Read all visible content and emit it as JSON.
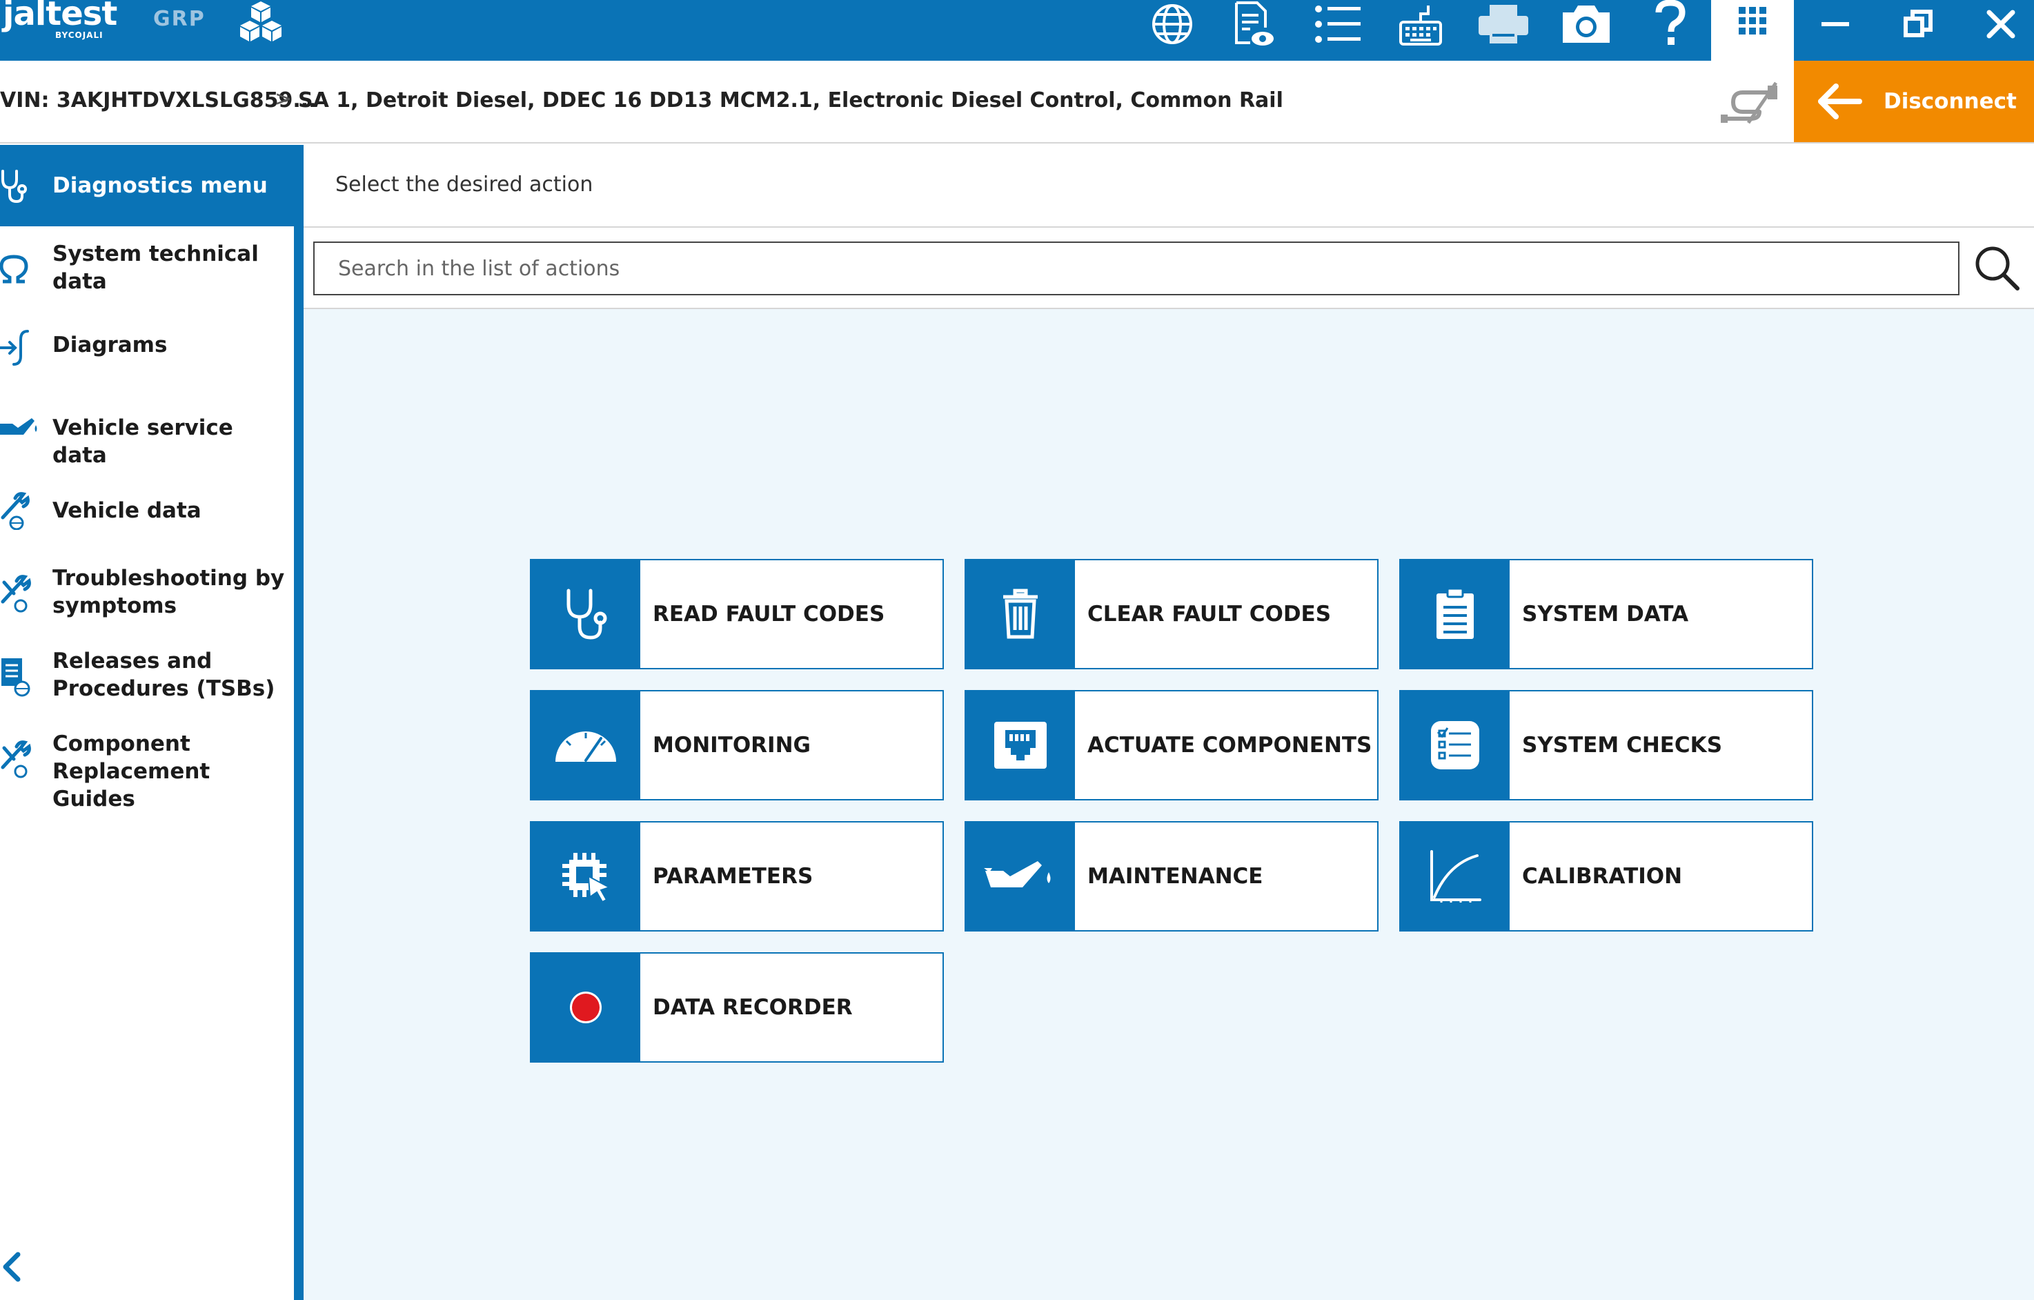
{
  "app": {
    "logo_text": "jaltest",
    "logo_sub": "BYCOJALI",
    "grp_label": "GRP"
  },
  "toolbar": {
    "icons": [
      "globe-icon",
      "document-view-icon",
      "list-icon",
      "keyboard-icon",
      "printer-icon",
      "camera-icon",
      "help-icon",
      "apps-grid-icon"
    ],
    "window_controls": [
      "minimize-icon",
      "restore-icon",
      "close-icon"
    ]
  },
  "breadcrumb": {
    "vin": "VIN: 3AKJHTDVXLSLG859...",
    "separator": ">",
    "system": "SA 1, Detroit Diesel, DDEC 16 DD13 MCM2.1, Electronic Diesel Control, Common Rail"
  },
  "disconnect": {
    "label": "Disconnect"
  },
  "sidebar": {
    "items": [
      {
        "label": "Diagnostics menu",
        "icon": "stethoscope-icon"
      },
      {
        "label": "System technical data",
        "icon": "omega-icon"
      },
      {
        "label": "Diagrams",
        "icon": "wiring-icon"
      },
      {
        "label": "Vehicle service data",
        "icon": "oil-can-icon"
      },
      {
        "label": "Vehicle data",
        "icon": "wrench-globe-icon"
      },
      {
        "label": "Troubleshooting by symptoms",
        "icon": "tools-globe-icon"
      },
      {
        "label": "Releases and Procedures (TSBs)",
        "icon": "document-globe-icon"
      },
      {
        "label": "Component Replacement Guides",
        "icon": "tools-globe-icon"
      }
    ]
  },
  "main": {
    "title": "Select the desired action",
    "search_placeholder": "Search in the list of actions"
  },
  "actions": [
    {
      "label": "READ FAULT CODES",
      "icon": "stethoscope-icon"
    },
    {
      "label": "CLEAR FAULT CODES",
      "icon": "trash-icon"
    },
    {
      "label": "SYSTEM DATA",
      "icon": "clipboard-icon"
    },
    {
      "label": "MONITORING",
      "icon": "gauge-icon"
    },
    {
      "label": "ACTUATE COMPONENTS",
      "icon": "connector-icon"
    },
    {
      "label": "SYSTEM CHECKS",
      "icon": "checklist-icon"
    },
    {
      "label": "PARAMETERS",
      "icon": "chip-cursor-icon"
    },
    {
      "label": "MAINTENANCE",
      "icon": "oil-can-icon"
    },
    {
      "label": "CALIBRATION",
      "icon": "curve-graph-icon"
    },
    {
      "label": "DATA RECORDER",
      "icon": "record-icon"
    }
  ],
  "colors": {
    "primary": "#0a73b6",
    "accent": "#f28a00",
    "content_bg": "#eef7fc",
    "record": "#e0191f"
  }
}
